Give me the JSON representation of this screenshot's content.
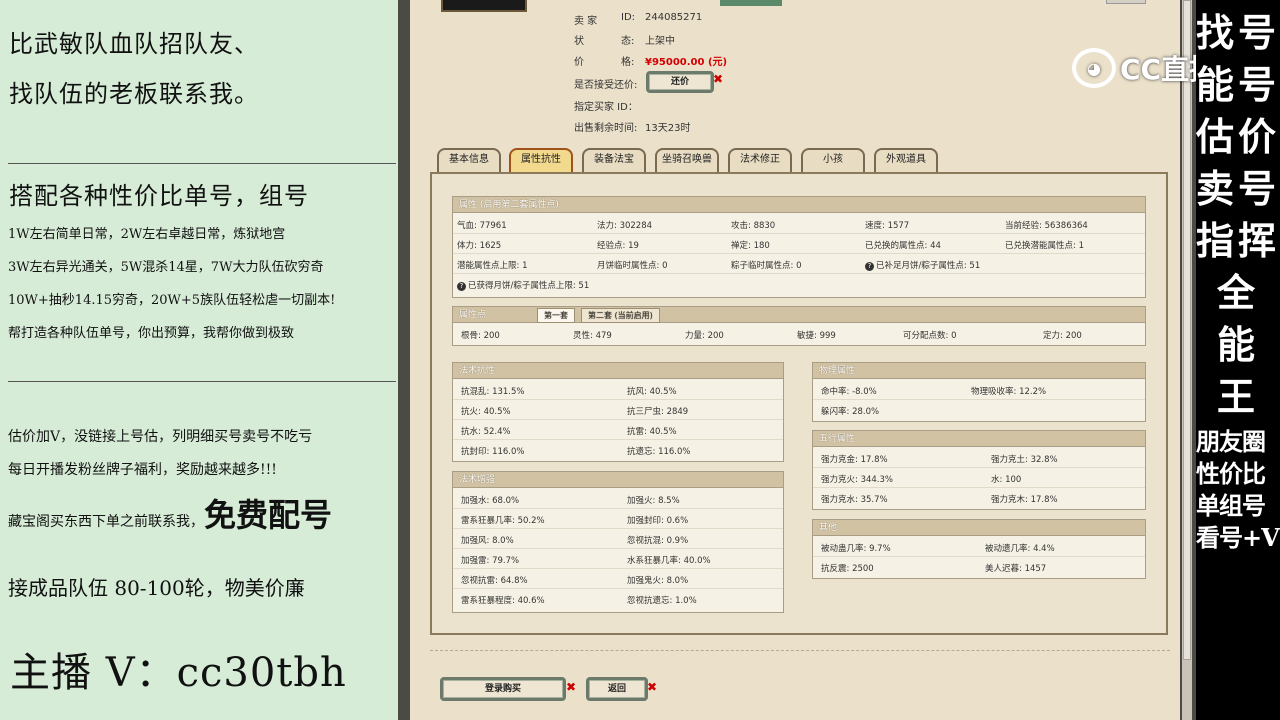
{
  "promo": {
    "line1": "比武敏队血队招队友、",
    "line2": "找队伍的老板联系我。",
    "line3": "搭配各种性价比单号，组号",
    "line4": "1W左右简单日常，2W左右卓越日常，炼狱地宫",
    "line5": "3W左右异光通关，5W混杀14星，7W大力队伍砍穷奇",
    "line6": "10W+抽秒14.15穷奇，20W+5族队伍轻松虐一切副本!",
    "line7": "帮打造各种队伍单号，你出预算，我帮你做到极致",
    "line8": "估价加V，没链接上号估，列明细买号卖号不吃亏",
    "line9": "每日开播发粉丝牌子福利，奖励越来越多!!!",
    "line10_pre": "藏宝阁买东西下单之前联系我，",
    "line10_big": "免费配号",
    "line11": "接成品队伍 80-100轮，物美价廉",
    "anchor": "主播 V：cc30tbh"
  },
  "listing": {
    "seller_label": "卖 家",
    "seller_id_label": "ID:",
    "seller_id": "244085271",
    "status_label": "状",
    "status_label2": "态:",
    "status": "上架中",
    "price_label": "价",
    "price_label2": "格:",
    "price": "¥95000.00 (元)",
    "counter_label": "是否接受还价:",
    "counter_btn": "还价",
    "buyer_label": "指定买家 ID：",
    "time_label": "出售剩余时间:",
    "time": "13天23时"
  },
  "tabs": [
    "基本信息",
    "属性抗性",
    "装备法宝",
    "坐骑召唤兽",
    "法术修正",
    "小孩",
    "外观道具"
  ],
  "attr": {
    "header": "属性 (启用第二套属性点)",
    "rows": [
      [
        "气血: 77961",
        "法力: 302284",
        "攻击: 8830",
        "速度: 1577",
        "当前经验: 56386364"
      ],
      [
        "体力: 1625",
        "经验点: 19",
        "禅定: 180",
        "已兑换的属性点: 44",
        "已兑换潜能属性点: 1"
      ],
      [
        "潜能属性点上限: 1",
        "月饼临时属性点: 0",
        "粽子临时属性点: 0",
        "已补足月饼/粽子属性点: 51",
        ""
      ],
      [
        "已获得月饼/粽子属性点上限: 51"
      ]
    ]
  },
  "points": {
    "header": "属性点",
    "tab1": "第一套",
    "tab2": "第二套 (当前启用)",
    "row": [
      "根骨: 200",
      "灵性: 479",
      "力量: 200",
      "敏捷: 999",
      "可分配点数: 0",
      "定力: 200"
    ]
  },
  "resist": {
    "header": "法术抗性",
    "rows": [
      [
        "抗混乱: 131.5%",
        "抗风: 40.5%"
      ],
      [
        "抗火: 40.5%",
        "抗三尸虫: 2849"
      ],
      [
        "抗水: 52.4%",
        "抗雷: 40.5%"
      ],
      [
        "抗封印: 116.0%",
        "抗遗忘: 116.0%"
      ]
    ]
  },
  "enhance": {
    "header": "法术增强",
    "rows": [
      [
        "加强水: 68.0%",
        "加强火: 8.5%"
      ],
      [
        "雷系狂暴几率: 50.2%",
        "加强封印: 0.6%"
      ],
      [
        "加强风: 8.0%",
        "忽视抗混: 0.9%"
      ],
      [
        "加强雷: 79.7%",
        "水系狂暴几率: 40.0%"
      ],
      [
        "忽视抗雷: 64.8%",
        "加强鬼火: 8.0%"
      ],
      [
        "雷系狂暴程度: 40.6%",
        "忽视抗遗忘: 1.0%"
      ]
    ]
  },
  "physical": {
    "header": "物理属性",
    "rows": [
      [
        "命中率: -8.0%",
        "物理吸收率: 12.2%"
      ],
      [
        "躲闪率: 28.0%",
        ""
      ]
    ]
  },
  "five": {
    "header": "五行属性",
    "rows": [
      [
        "强力克金: 17.8%",
        "强力克土: 32.8%"
      ],
      [
        "强力克火: 344.3%",
        "水: 100"
      ],
      [
        "强力克水: 35.7%",
        "强力克木: 17.8%"
      ]
    ]
  },
  "other": {
    "header": "其他",
    "rows": [
      [
        "被动蛊几率: 9.7%",
        "被动遗几率: 4.4%"
      ],
      [
        "抗反震: 2500",
        "美人迟暮: 1457"
      ]
    ]
  },
  "buttons": {
    "buy": "登录购买",
    "back": "返回"
  },
  "banner": {
    "chars": [
      "找",
      "号",
      "能",
      "号",
      "估",
      "价",
      "卖",
      "号",
      "指",
      "挥",
      "全",
      "能",
      "王"
    ],
    "lines": [
      "朋友圈",
      "性价比",
      "单组号",
      "看号+V"
    ]
  },
  "logo": {
    "text": "CC直播"
  }
}
